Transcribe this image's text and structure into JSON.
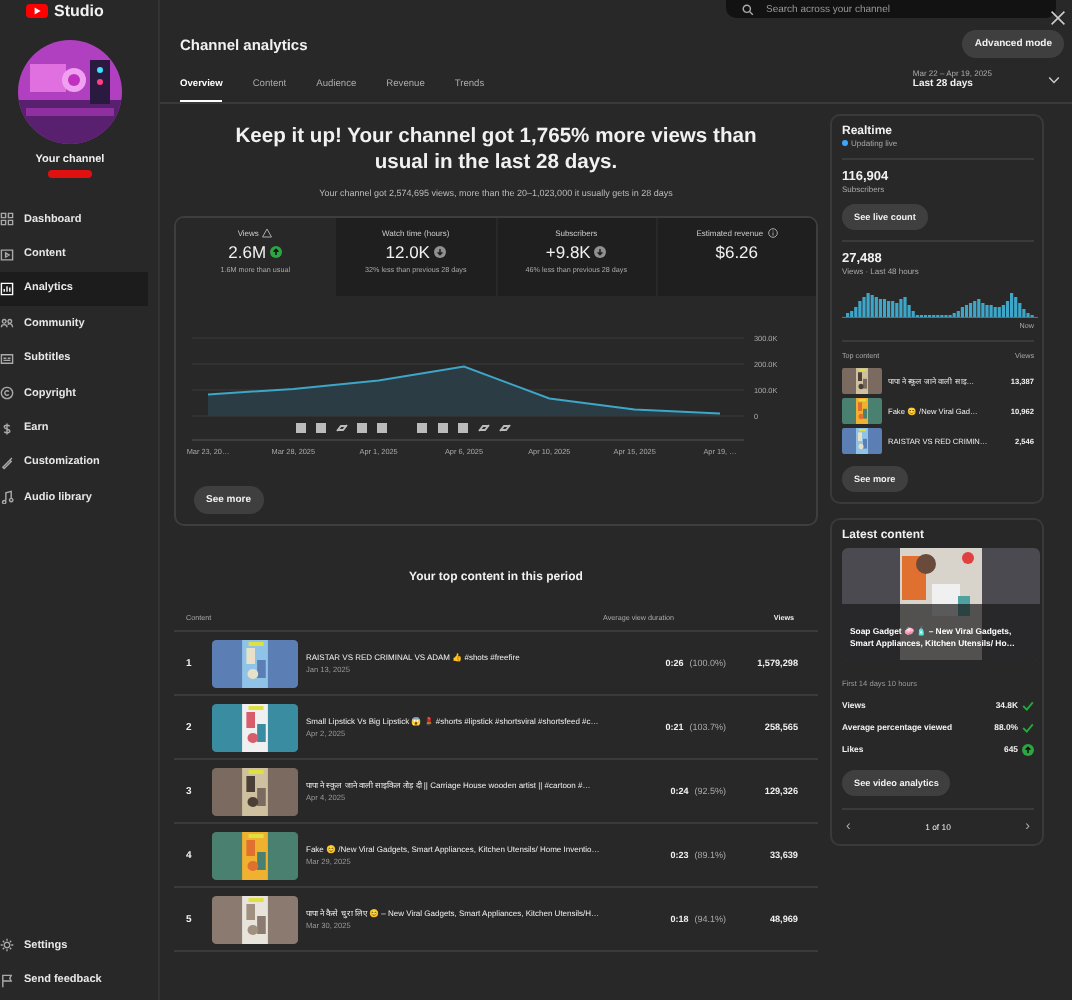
{
  "logo": {
    "text": "Studio"
  },
  "search": {
    "placeholder": "Search across your channel"
  },
  "channel": {
    "name": "Your channel"
  },
  "sidebar": {
    "items": [
      {
        "label": "Dashboard",
        "selected": false
      },
      {
        "label": "Content",
        "selected": false
      },
      {
        "label": "Analytics",
        "selected": true
      },
      {
        "label": "Community",
        "selected": false
      },
      {
        "label": "Subtitles",
        "selected": false
      },
      {
        "label": "Copyright",
        "selected": false
      },
      {
        "label": "Earn",
        "selected": false
      },
      {
        "label": "Customization",
        "selected": false
      },
      {
        "label": "Audio library",
        "selected": false
      }
    ],
    "bottom_items": [
      {
        "label": "Settings"
      },
      {
        "label": "Send feedback"
      }
    ]
  },
  "header": {
    "title": "Channel analytics",
    "advanced_button": "Advanced mode",
    "date_range": "Mar 22 – Apr 19, 2025",
    "period": "Last 28 days"
  },
  "tabs": [
    {
      "label": "Overview",
      "selected": true
    },
    {
      "label": "Content",
      "selected": false
    },
    {
      "label": "Audience",
      "selected": false
    },
    {
      "label": "Revenue",
      "selected": false
    },
    {
      "label": "Trends",
      "selected": false
    }
  ],
  "headline": "Keep it up! Your channel got 1,765% more views than usual in the last 28 days.",
  "subheadline": "Your channel got 2,574,695 views, more than the 20–1,023,000 it usually gets in 28 days",
  "metrics": [
    {
      "label": "Views",
      "warning": true,
      "value": "2.6M",
      "trend_up": true,
      "note": "1.6M more than usual",
      "selected": true
    },
    {
      "label": "Watch time (hours)",
      "value": "12.0K",
      "trend_up": false,
      "note": "32% less than previous 28 days",
      "selected": false
    },
    {
      "label": "Subscribers",
      "value": "+9.8K",
      "trend_up": false,
      "note": "46% less than previous 28 days",
      "selected": false
    },
    {
      "label": "Estimated revenue",
      "info": true,
      "value": "$6.26",
      "selected": false
    }
  ],
  "chart_data": {
    "type": "area",
    "categories": [
      "Mar 23, 20…",
      "Mar 28, 2025",
      "Apr 1, 2025",
      "Apr 6, 2025",
      "Apr 10, 2025",
      "Apr 15, 2025",
      "Apr 19, …"
    ],
    "values": [
      83000,
      104000,
      137000,
      190000,
      68000,
      25000,
      10000
    ],
    "ylim": [
      0,
      300000
    ],
    "yticks": [
      {
        "value": 0,
        "label": "0"
      },
      {
        "value": 100000,
        "label": "100.0K"
      },
      {
        "value": 200000,
        "label": "200.0K"
      },
      {
        "value": 300000,
        "label": "300.0K"
      }
    ]
  },
  "see_more": "See more",
  "top_content": {
    "title": "Your top content in this period",
    "columns": [
      "Content",
      "Average view duration",
      "Views"
    ],
    "rows": [
      {
        "rank": "1",
        "title": "RAISTAR VS RED CRIMINAL VS ADAM 👍 #shots #freefire",
        "date": "Jan 13, 2025",
        "duration": "0:26",
        "percent": "(100.0%)",
        "views": "1,579,298"
      },
      {
        "rank": "2",
        "title": "Small Lipstick Vs Big Lipstick 😱 💄 #shorts #lipstick #shortsviral #shortsfeed #c…",
        "date": "Apr 2, 2025",
        "duration": "0:21",
        "percent": "(103.7%)",
        "views": "258,565"
      },
      {
        "rank": "3",
        "title": "पापा ने स्कूल जाने वाली साइकिल तोड़ दी || Carriage House wooden artist || #cartoon #…",
        "date": "Apr 4, 2025",
        "duration": "0:24",
        "percent": "(92.5%)",
        "views": "129,326"
      },
      {
        "rank": "4",
        "title": "Fake 😊 /New Viral Gadgets, Smart Appliances, Kitchen Utensils/ Home Inventio…",
        "date": "Mar 29, 2025",
        "duration": "0:23",
        "percent": "(89.1%)",
        "views": "33,639"
      },
      {
        "rank": "5",
        "title": "पापा ने कैसे चुरा लिए 😊 – New Viral Gadgets, Smart Appliances, Kitchen Utensils/H…",
        "date": "Mar 30, 2025",
        "duration": "0:18",
        "percent": "(94.1%)",
        "views": "48,969"
      }
    ]
  },
  "realtime": {
    "title": "Realtime",
    "status": "Updating live",
    "subscribers": "116,904",
    "subscribers_label": "Subscribers",
    "live_button": "See live count",
    "views": "27,488",
    "views_label": "Views · Last 48 hours",
    "now_label": "Now",
    "top_label": "Top content",
    "views_column": "Views",
    "items": [
      {
        "title": "पापा ने स्कूल जाने वाली साइ…",
        "views": "13,387"
      },
      {
        "title": "Fake 😊 /New Viral Gad…",
        "views": "10,962"
      },
      {
        "title": "RAISTAR VS RED CRIMIN…",
        "views": "2,546"
      }
    ],
    "see_more": "See more"
  },
  "latest": {
    "title": "Latest content",
    "video_title": "Soap Gadget 🧼 🧴 – New Viral Gadgets, Smart Appliances, Kitchen Utensils/ Ho…",
    "period": "First 14 days 10 hours",
    "stats": [
      {
        "label": "Views",
        "value": "34.8K",
        "kind": "check"
      },
      {
        "label": "Average percentage viewed",
        "value": "88.0%",
        "kind": "check"
      },
      {
        "label": "Likes",
        "value": "645",
        "kind": "up"
      }
    ],
    "button": "See video analytics",
    "pager": "1 of 10",
    "prev": "‹",
    "next": "›"
  }
}
